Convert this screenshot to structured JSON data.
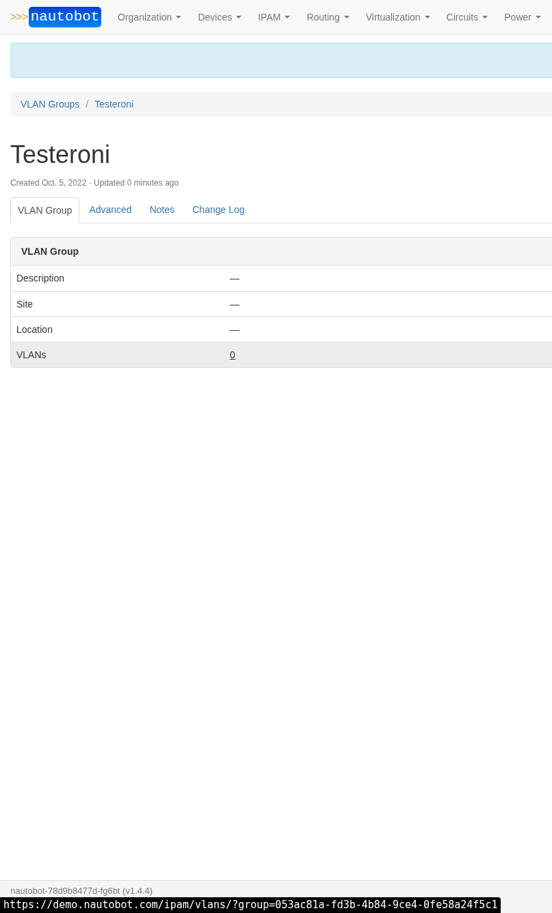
{
  "navbar": {
    "brand": "nautobot",
    "brand_arrows": ">>>",
    "menus": [
      {
        "label": "Organization"
      },
      {
        "label": "Devices"
      },
      {
        "label": "IPAM"
      },
      {
        "label": "Routing"
      },
      {
        "label": "Virtualization"
      },
      {
        "label": "Circuits"
      },
      {
        "label": "Power"
      }
    ]
  },
  "breadcrumb": [
    "VLAN Groups",
    "Testeroni"
  ],
  "breadcrumb_separator": "/",
  "title": "Testeroni",
  "meta": "Created Oct. 5, 2022 · Updated 0 minutes ago",
  "tabs": [
    {
      "label": "VLAN Group",
      "selected": true
    },
    {
      "label": "Advanced",
      "selected": false
    },
    {
      "label": "Notes",
      "selected": false
    },
    {
      "label": "Change Log",
      "selected": false
    }
  ],
  "panel": {
    "heading": "VLAN Group",
    "rows": [
      {
        "label": "Description",
        "value": "—",
        "kind": "text",
        "highlighted": false
      },
      {
        "label": "Site",
        "value": "—",
        "kind": "text",
        "highlighted": false
      },
      {
        "label": "Location",
        "value": "—",
        "kind": "text",
        "highlighted": false
      },
      {
        "label": "VLANs",
        "value": "0",
        "kind": "link",
        "highlighted": true
      }
    ]
  },
  "footer": {
    "version": "nautobot-78d9b8477d-fg6bt (v1.4.4)"
  },
  "status_url": "https://demo.nautobot.com/ipam/vlans/?group=053ac81a-fd3b-4b84-9ce4-0fe58a24f5c1"
}
